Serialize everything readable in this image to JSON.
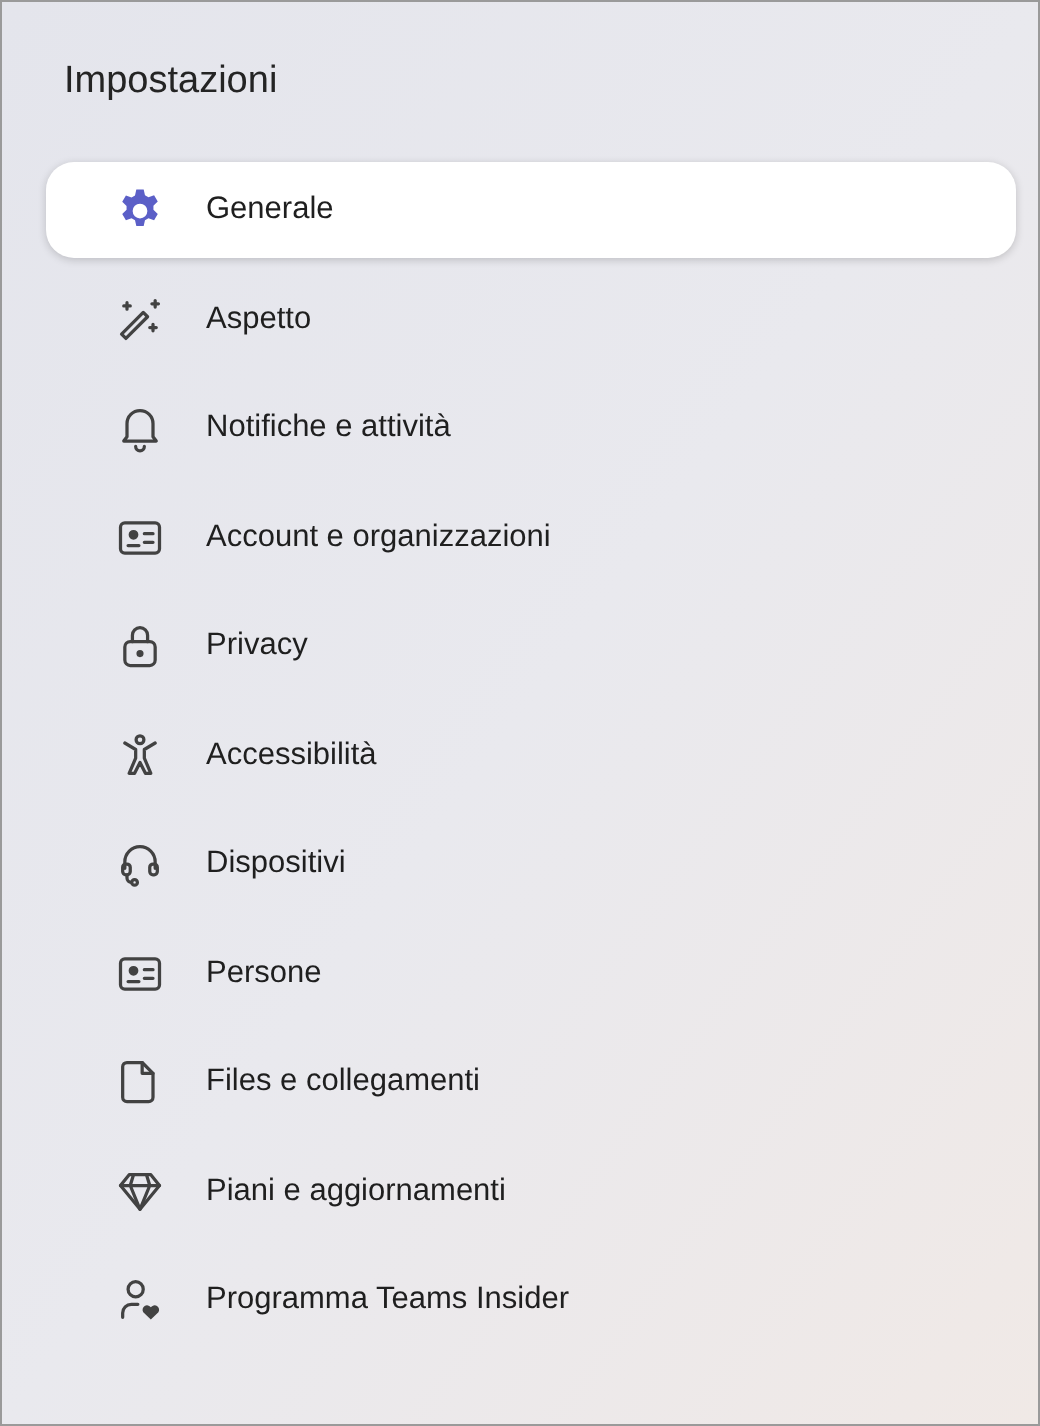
{
  "title": "Impostazioni",
  "items": [
    {
      "label": "Generale",
      "selected": true
    },
    {
      "label": "Aspetto",
      "selected": false
    },
    {
      "label": "Notifiche e attività",
      "selected": false
    },
    {
      "label": "Account e organizzazioni",
      "selected": false
    },
    {
      "label": "Privacy",
      "selected": false
    },
    {
      "label": "Accessibilità",
      "selected": false
    },
    {
      "label": "Dispositivi",
      "selected": false
    },
    {
      "label": "Persone",
      "selected": false
    },
    {
      "label": "Files e collegamenti",
      "selected": false
    },
    {
      "label": "Piani e aggiornamenti",
      "selected": false
    },
    {
      "label": "Programma Teams Insider",
      "selected": false
    }
  ]
}
